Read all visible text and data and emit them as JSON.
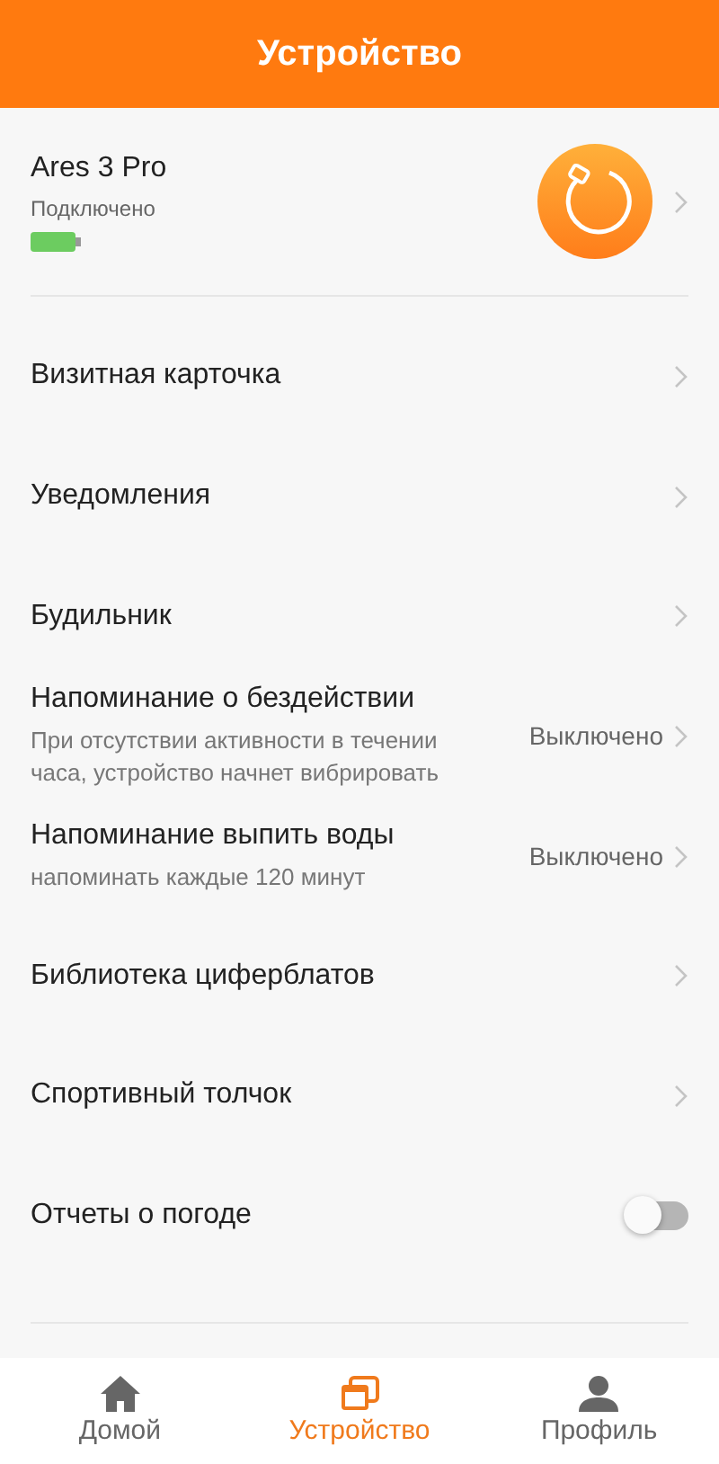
{
  "header": {
    "title": "Устройство"
  },
  "device": {
    "name": "Ares 3 Pro",
    "status": "Подключено"
  },
  "settings": [
    {
      "kind": "link",
      "label": "Визитная карточка"
    },
    {
      "kind": "link",
      "label": "Уведомления"
    },
    {
      "kind": "link",
      "label": "Будильник"
    },
    {
      "kind": "link",
      "label": "Напоминание о бездействии",
      "description": "При отсутствии активности в течении часа, устройство начнет вибрировать",
      "value": "Выключено"
    },
    {
      "kind": "link",
      "label": "Напоминание выпить воды",
      "description": "напоминать каждые 120 минут",
      "value": "Выключено"
    },
    {
      "kind": "link",
      "label": "Библиотека циферблатов"
    },
    {
      "kind": "link",
      "label": "Спортивный толчок"
    },
    {
      "kind": "toggle",
      "label": "Отчеты о погоде",
      "on": false
    }
  ],
  "tab_bar": [
    {
      "kind": "home",
      "label": "Домой",
      "selected": false
    },
    {
      "kind": "device",
      "label": "Устройство",
      "selected": true
    },
    {
      "kind": "profile",
      "label": "Профиль",
      "selected": false
    }
  ]
}
